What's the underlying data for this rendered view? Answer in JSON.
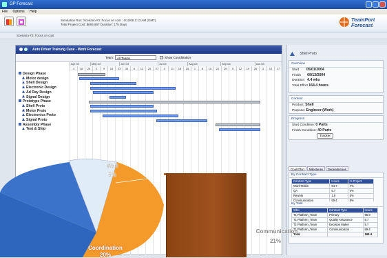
{
  "window": {
    "title": "GP Forecast"
  },
  "menu": [
    "File",
    "Options",
    "Help"
  ],
  "header": {
    "line1": "Simulation Run:    Scenario #3: Focus on cost : 4/12/08 2:13 AM (GMT)",
    "line2": "Total Project Cost:   $694,867   Duration:   175 Days",
    "logo_top": "TeamPort",
    "logo_bottom": "Forecast"
  },
  "subbar": "Scenario #3: Focus on cost",
  "gantt": {
    "title": "Auto Driver Training Case - Work Forecast",
    "team_label": "Team:",
    "team_value": "All Teams",
    "show_coord_label": "Show Coordination",
    "months": [
      "Apr 04",
      "May 04",
      "Jun 04",
      "Jul 04",
      "Aug 04",
      "Sep 04",
      "Oct 04"
    ],
    "days": [
      "4",
      "18",
      "25",
      "2",
      "9",
      "16",
      "23",
      "30",
      "6",
      "13",
      "20",
      "27",
      "4",
      "11",
      "18",
      "25",
      "1",
      "8",
      "15",
      "22",
      "29",
      "5",
      "12",
      "19",
      "26",
      "3",
      "10",
      "17"
    ],
    "rows": [
      "Design Phase",
      "Motor design",
      "Shell Design",
      "Electronic Design",
      "Ad Ray Design",
      "Signal Design",
      "Prototype Phase",
      "Shell Proto",
      "Motor Proto",
      "Electronics Proto",
      "Signal Proto",
      "Assembly Phase",
      "Test & Ship"
    ]
  },
  "side": {
    "shell_label": "Shell Proto",
    "overview": {
      "head": "Overview",
      "start_label": "Start",
      "start": "05/01/2004",
      "finish_label": "Finish",
      "finish": "09/13/2004",
      "duration_label": "Duration",
      "duration": "4.4 wks",
      "effort_label": "Total Effort",
      "effort": "164.4 hours"
    },
    "context": {
      "head": "Context",
      "product_label": "Product:",
      "product": "Shell",
      "purpose_label": "Purpose:",
      "purpose": "Engineer (Work)"
    },
    "progress": {
      "head": "Progress",
      "start_label": "Start Condition:",
      "start_val": "0 Parts",
      "finish_label": "Finish Condition:",
      "finish_val": "40 Parts",
      "button": "Tracker"
    },
    "tabs": [
      "Goal Effort",
      "Milestones",
      "Dependencies"
    ],
    "by_contract": {
      "head": "By Contract Type",
      "cols": [
        "Contract Type",
        "Hours",
        "% Project"
      ],
      "rows": [
        [
          "Work-Robin",
          "94.7",
          "7%"
        ],
        [
          "QA",
          "5.7",
          "4%"
        ],
        [
          "Rework",
          "1.9",
          "5%"
        ],
        [
          "Communication",
          "59.4",
          "8%"
        ],
        [
          "Decision",
          "5.7",
          "1%"
        ],
        [
          "Total",
          "164.4",
          "7%"
        ]
      ]
    },
    "by_task": {
      "head": "By Task",
      "cols": [
        "Who",
        "Contract Type",
        "Hours"
      ],
      "rows": [
        [
          "T1 Platform_Team",
          "Primary",
          "95.9"
        ],
        [
          "T1 Platform_Team",
          "Quality Assurance",
          "5.7"
        ],
        [
          "T1 Platform_Team",
          "Decision Maker",
          "5.7"
        ],
        [
          "T1 Platform_Team",
          "Communication",
          "59.4"
        ],
        [
          "Total",
          "",
          "164.4"
        ]
      ]
    }
  },
  "overlay": {
    "wait_label": "Wait",
    "wait_pct": "5%",
    "coord_label": "Coordination",
    "coord_pct": "20%",
    "comm_label": "Communication",
    "comm_pct": "21%"
  },
  "colors": {
    "pie_blue": "#3a73c9",
    "pie_orange": "#f49a2a",
    "bar_brown": "#8b4513"
  }
}
